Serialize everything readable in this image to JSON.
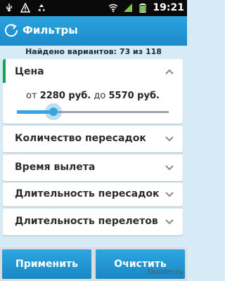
{
  "status_bar": {
    "time": "19:21",
    "left_icons": [
      "usb-icon",
      "warning-icon",
      "recycle-icon"
    ],
    "right_icons": [
      "wifi-icon",
      "signal-icon",
      "battery-icon"
    ]
  },
  "action_bar": {
    "title": "Фильтры",
    "back_icon": "back-arrow-icon"
  },
  "found_text": "Найдено вариантов: 73 из 118",
  "price_filter": {
    "label": "Цена",
    "from_word": "от",
    "from_value": "2280 руб.",
    "to_word": "до",
    "to_value": "5570 руб.",
    "slider_position": 0.24
  },
  "filters": [
    {
      "label": "Количество пересадок"
    },
    {
      "label": "Время вылета"
    },
    {
      "label": "Длительность пересадок"
    },
    {
      "label": "Длительность перелетов"
    }
  ],
  "buttons": {
    "apply": "Применить",
    "clear": "Очистить"
  },
  "watermark": "Droider.ru",
  "colors": {
    "accent": "#1aa44a",
    "brand": "#1b8cc9",
    "slider": "#38a3e0"
  }
}
